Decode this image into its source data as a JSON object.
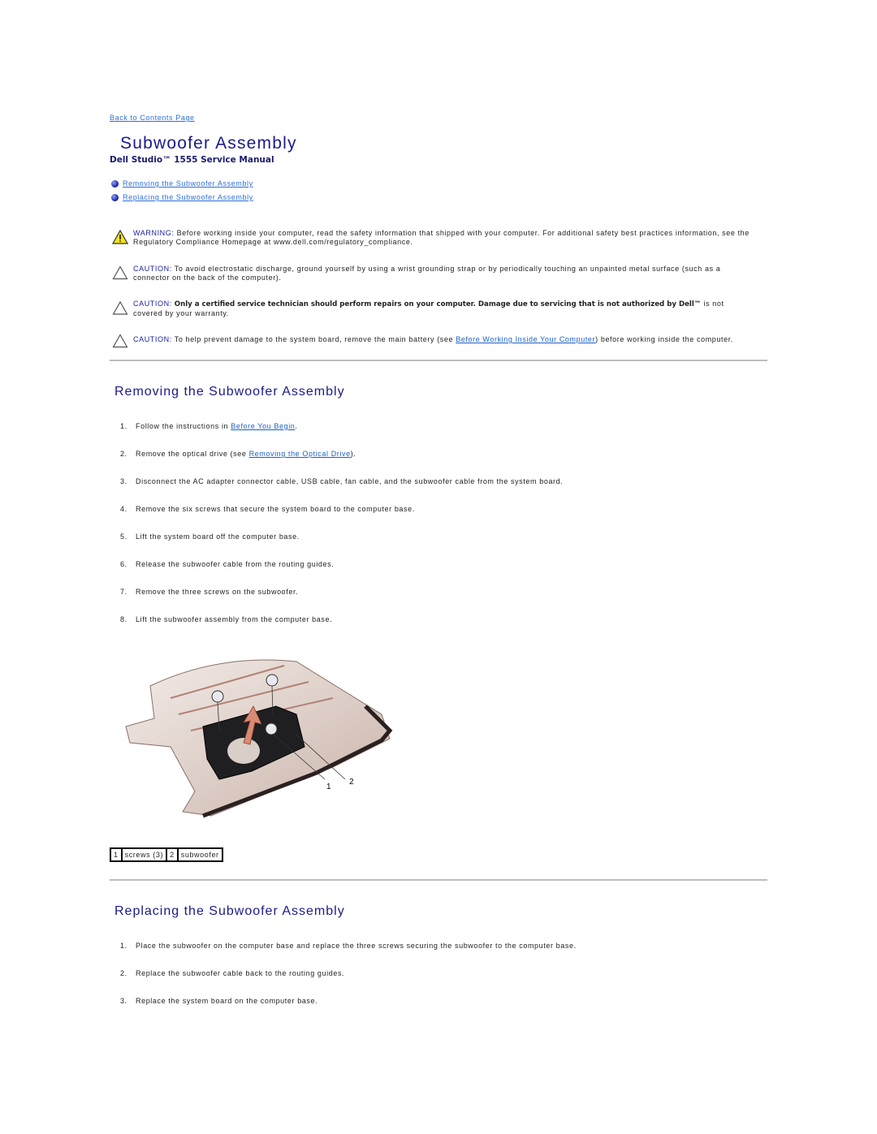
{
  "header": {
    "back_link": "Back to Contents Page",
    "title": "Subwoofer Assembly",
    "subtitle": "Dell Studio™ 1555 Service Manual"
  },
  "toc": [
    {
      "label": "Removing the Subwoofer Assembly",
      "icon": "bullet-icon"
    },
    {
      "label": "Replacing the Subwoofer Assembly",
      "icon": "bullet-icon"
    }
  ],
  "notices": [
    {
      "type": "warning",
      "icon": "warning-triangle-icon",
      "label": "WARNING:",
      "text": " Before working inside your computer, read the safety information that shipped with your computer. For additional safety best practices information, see the Regulatory Compliance Homepage at www.dell.com/regulatory_compliance."
    },
    {
      "type": "caution",
      "icon": "caution-triangle-icon",
      "label": "CAUTION:",
      "text": " To avoid electrostatic discharge, ground yourself by using a wrist grounding strap or by periodically touching an unpainted metal surface (such as a connector on the back of the computer)."
    },
    {
      "type": "caution",
      "icon": "caution-triangle-icon",
      "label": "CAUTION:",
      "bold": " Only a certified service technician should perform repairs on your computer. Damage due to servicing that is not authorized by Dell™",
      "text": " is not covered by your warranty."
    },
    {
      "type": "caution",
      "icon": "caution-triangle-icon",
      "label": "CAUTION:",
      "text_before": " To help prevent damage to the system board, remove the main battery (see ",
      "link": "Before Working Inside Your Computer",
      "text_after": ") before working inside the computer."
    }
  ],
  "removing": {
    "heading": "Removing the Subwoofer Assembly",
    "steps": [
      {
        "num": "1.",
        "before": "Follow the instructions in ",
        "link": "Before You Begin",
        "after": "."
      },
      {
        "num": "2.",
        "before": "Remove the optical drive (see ",
        "link": "Removing the Optical Drive",
        "after": ")."
      },
      {
        "num": "3.",
        "text": "Disconnect the AC adapter connector cable, USB cable, fan cable, and the subwoofer cable from the system board."
      },
      {
        "num": "4.",
        "text": "Remove the six screws that secure the system board to the computer base."
      },
      {
        "num": "5.",
        "text": "Lift the system board off the computer base."
      },
      {
        "num": "6.",
        "text": "Release the subwoofer cable from the routing guides."
      },
      {
        "num": "7.",
        "text": "Remove the three screws on the subwoofer."
      },
      {
        "num": "8.",
        "text": "Lift the subwoofer assembly from the computer base."
      }
    ],
    "figure": {
      "description": "subwoofer-assembly-illustration",
      "callouts": [
        "1",
        "2"
      ]
    },
    "legend": [
      {
        "num": "1",
        "label": "screws (3)"
      },
      {
        "num": "2",
        "label": "subwoofer"
      }
    ]
  },
  "replacing": {
    "heading": "Replacing the Subwoofer Assembly",
    "steps": [
      {
        "num": "1.",
        "text": "Place the subwoofer on the computer base and replace the three screws securing the subwoofer to the computer base."
      },
      {
        "num": "2.",
        "text": "Replace the subwoofer cable back to the routing guides."
      },
      {
        "num": "3.",
        "text": "Replace the system board on the computer base."
      }
    ]
  },
  "colors": {
    "heading": "#1a1a8c",
    "link": "#2f6fd6",
    "label": "#1a22a0",
    "rule": "#bdbdbd"
  }
}
